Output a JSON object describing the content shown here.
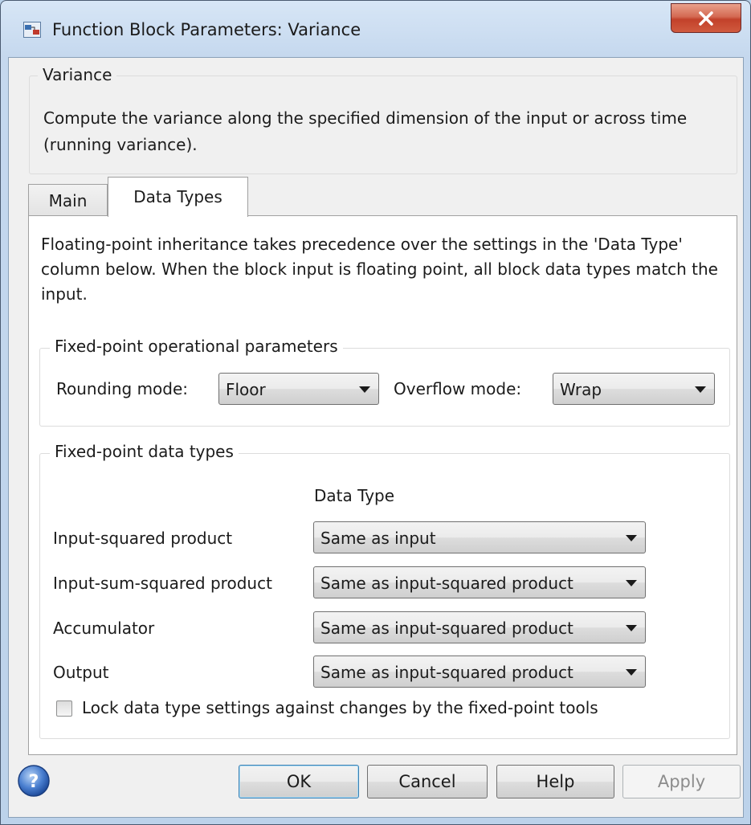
{
  "window": {
    "title": "Function Block Parameters: Variance"
  },
  "description": {
    "group_title": "Variance",
    "text": "Compute the variance along the specified dimension of the input or across time (running variance)."
  },
  "tabs": [
    {
      "label": "Main",
      "selected": false
    },
    {
      "label": "Data Types",
      "selected": true
    }
  ],
  "data_types_tab": {
    "intro": "Floating-point inheritance takes precedence over the settings in the 'Data Type' column below. When the block input is floating point, all block data types match the input.",
    "fixed_point_params": {
      "group_title": "Fixed-point operational parameters",
      "rounding_label": "Rounding mode:",
      "rounding_value": "Floor",
      "overflow_label": "Overflow mode:",
      "overflow_value": "Wrap"
    },
    "fixed_point_types": {
      "group_title": "Fixed-point data types",
      "column_header": "Data Type",
      "rows": [
        {
          "label": "Input-squared product",
          "value": "Same as input"
        },
        {
          "label": "Input-sum-squared product",
          "value": "Same as input-squared product"
        },
        {
          "label": "Accumulator",
          "value": "Same as input-squared product"
        },
        {
          "label": "Output",
          "value": "Same as input-squared product"
        }
      ],
      "lock_label": "Lock data type settings against changes by the fixed-point tools",
      "lock_checked": false
    }
  },
  "footer": {
    "ok": "OK",
    "cancel": "Cancel",
    "help": "Help",
    "apply": "Apply"
  },
  "icons": {
    "title": "simulink-block-icon",
    "close": "close-icon",
    "help": "help-question-icon",
    "dropdown": "chevron-down-icon"
  }
}
